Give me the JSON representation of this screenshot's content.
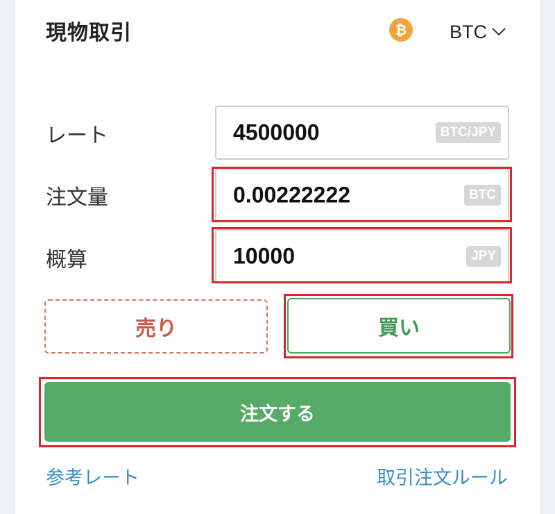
{
  "header": {
    "title": "現物取引",
    "coin_symbol": "₿",
    "currency": "BTC"
  },
  "form": {
    "rate": {
      "label": "レート",
      "value": "4500000",
      "unit": "BTC/JPY"
    },
    "amount": {
      "label": "注文量",
      "value": "0.00222222",
      "unit": "BTC"
    },
    "estimate": {
      "label": "概算",
      "value": "10000",
      "unit": "JPY"
    }
  },
  "actions": {
    "sell_label": "売り",
    "buy_label": "買い",
    "order_label": "注文する"
  },
  "links": {
    "reference_rate": "参考レート",
    "trading_rules": "取引注文ルール"
  },
  "colors": {
    "highlight": "#d8262a",
    "buy_green": "#57ab68",
    "sell_red": "#cc5a45",
    "bitcoin_orange": "#f2a43a",
    "link_blue": "#3a8fc4"
  }
}
